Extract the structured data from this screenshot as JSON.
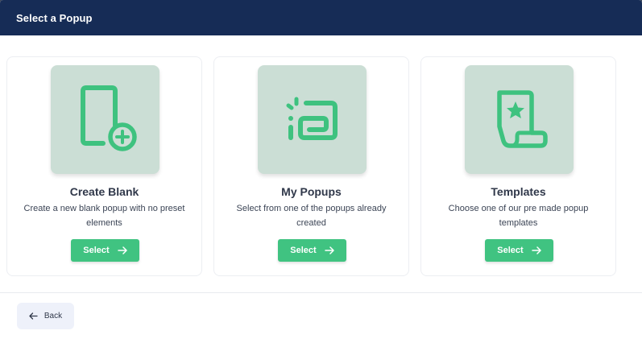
{
  "modal": {
    "title": "Select a Popup"
  },
  "cards": [
    {
      "title": "Create Blank",
      "description": "Create a new blank popup with no preset elements",
      "button_label": "Select",
      "icon": "blank-document-plus-icon"
    },
    {
      "title": "My Popups",
      "description": "Select from one of the popups already created",
      "button_label": "Select",
      "icon": "my-popups-icon"
    },
    {
      "title": "Templates",
      "description": "Choose one of our pre made popup templates",
      "button_label": "Select",
      "icon": "template-scroll-star-icon"
    }
  ],
  "footer": {
    "back_label": "Back"
  },
  "colors": {
    "header": "#162c56",
    "accent": "#40c381",
    "icon_tile": "#cbded5",
    "icon_stroke": "#3ec27f"
  }
}
